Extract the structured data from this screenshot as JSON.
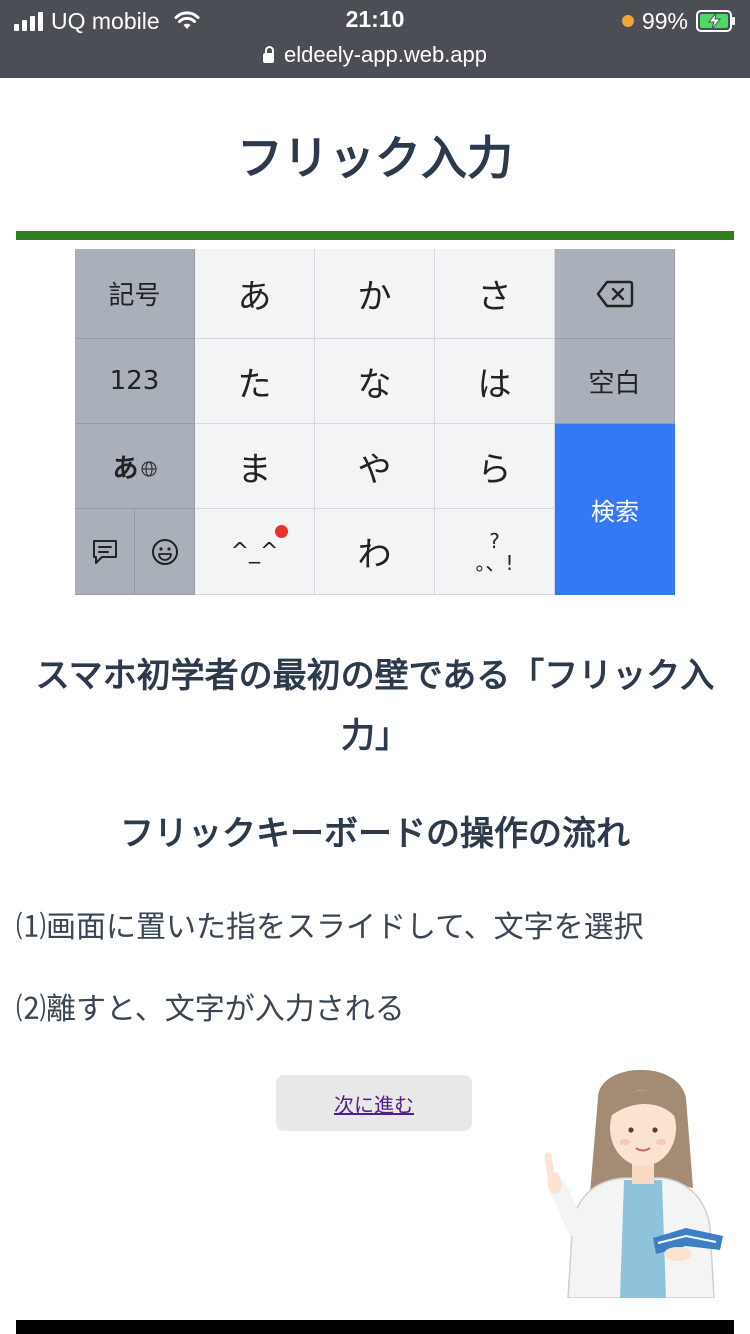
{
  "status_bar": {
    "carrier": "UQ mobile",
    "time": "21:10",
    "battery_percent": "99%",
    "url": "eldeely-app.web.app"
  },
  "page": {
    "title": "フリック入力",
    "accent_color": "#2e7d1e"
  },
  "keyboard": {
    "keys": {
      "kigou": "記号",
      "a": "あ",
      "ka": "か",
      "sa": "さ",
      "num": "123",
      "ta": "た",
      "na": "な",
      "ha": "は",
      "space": "空白",
      "kana": "あ",
      "ma": "ま",
      "ya": "や",
      "ra": "ら",
      "search": "検索",
      "kaomoji": "^_^",
      "wa": "わ",
      "punct_top": "?",
      "punct_bottom": "。、!"
    },
    "icons": [
      "backspace-icon",
      "globe-icon",
      "chat-icon",
      "emoji-icon"
    ],
    "search_color": "#3478f6"
  },
  "content": {
    "subtitle": "スマホ初学者の最初の壁である「フリック入力」",
    "section_title": "フリックキーボードの操作の流れ",
    "step1": "⑴画面に置いた指をスライドして、文字を選択",
    "step2": "⑵離すと、文字が入力される",
    "next_button": "次に進む"
  }
}
